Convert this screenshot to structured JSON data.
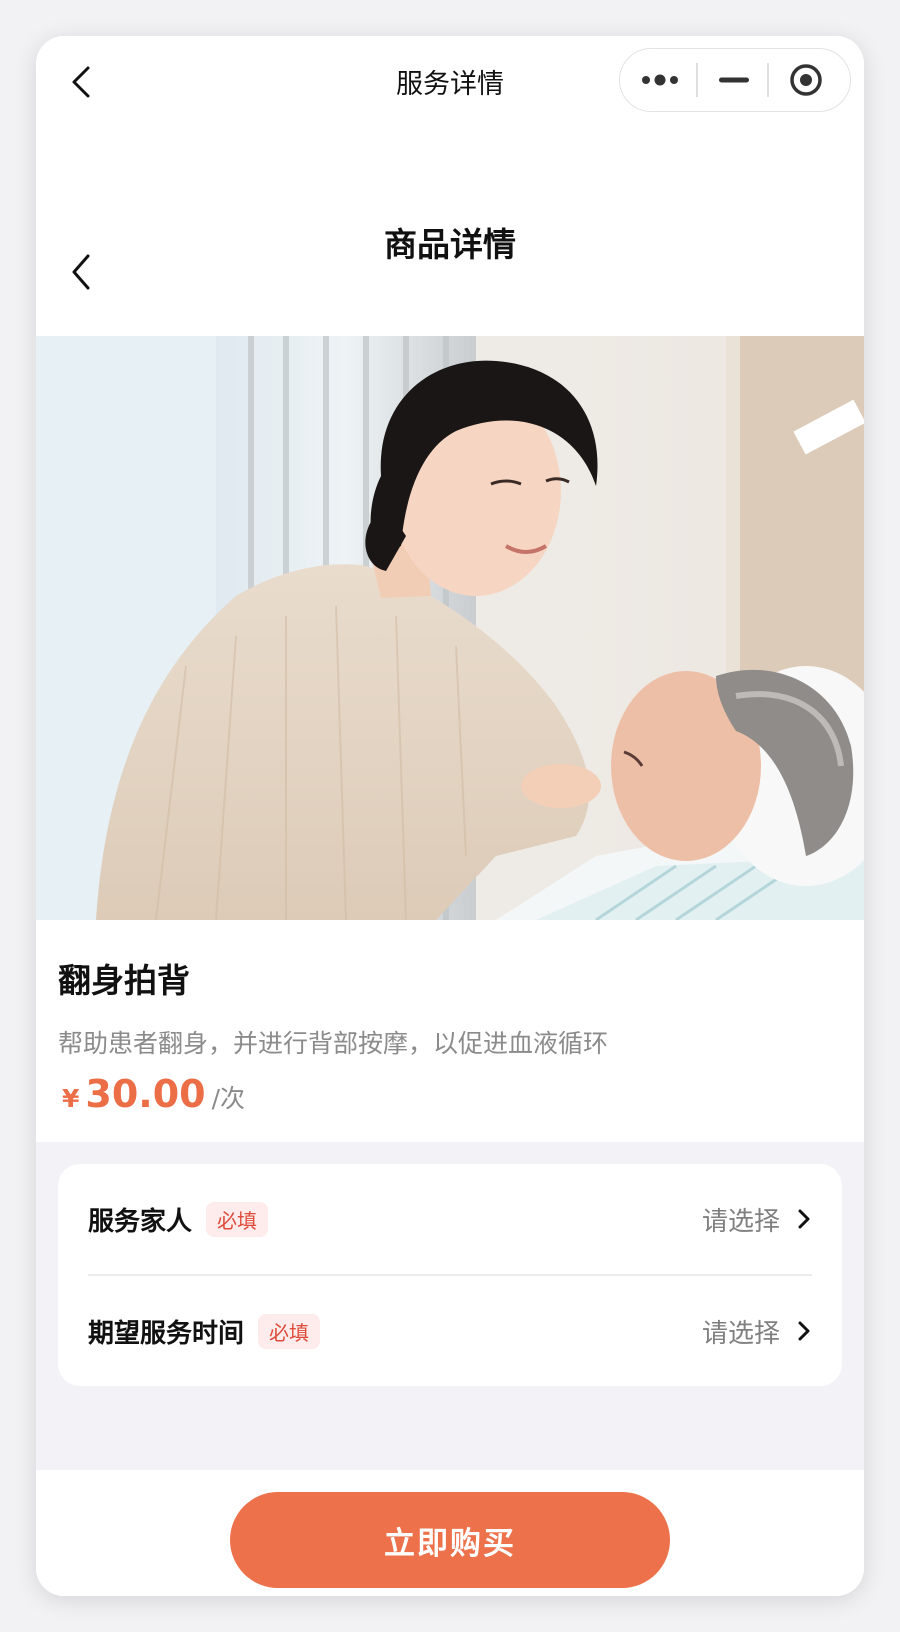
{
  "topbar": {
    "title": "服务详情",
    "back_icon": "chevron-left-icon",
    "menu_icon": "more-dots-icon",
    "minimize_icon": "minus-icon",
    "close_icon": "target-circle-icon"
  },
  "page": {
    "title": "商品详情",
    "back_icon": "chevron-left-icon"
  },
  "hero": {
    "image": "caregiver-with-elderly-patient-photo"
  },
  "product": {
    "name": "翻身拍背",
    "description": "帮助患者翻身，并进行背部按摩，以促进血液循环",
    "currency_symbol": "¥",
    "price": "30.00",
    "unit": "/次"
  },
  "form": {
    "rows": [
      {
        "label": "服务家人",
        "badge": "必填",
        "value": "请选择"
      },
      {
        "label": "期望服务时间",
        "badge": "必填",
        "value": "请选择"
      }
    ]
  },
  "footer": {
    "buy_label": "立即购买"
  },
  "colors": {
    "accent": "#ed714b",
    "badge_bg": "#fdeceb",
    "badge_text": "#dd4b3a"
  }
}
